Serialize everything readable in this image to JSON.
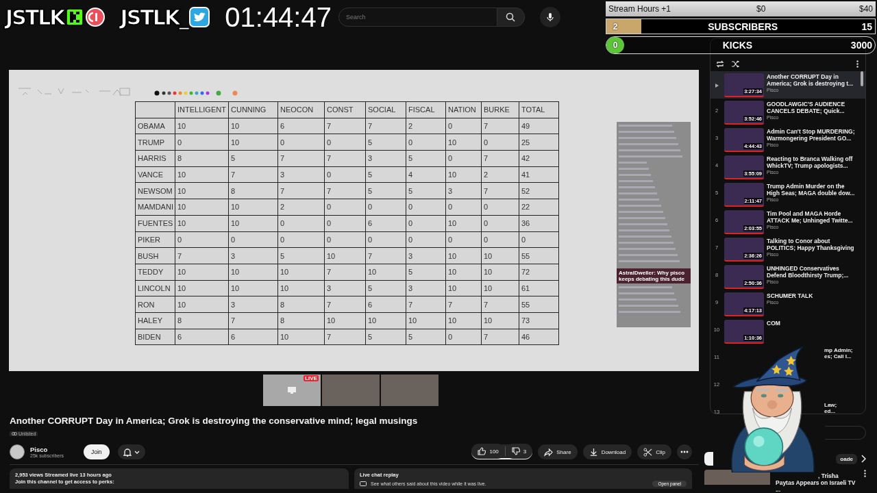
{
  "overlay": {
    "logos": [
      {
        "text": "JSTLK",
        "kind": "kick"
      },
      {
        "text": "JSTLK_",
        "kind": "twitter"
      }
    ],
    "timer": "01:44:47"
  },
  "search": {
    "placeholder": "Search"
  },
  "goals": [
    {
      "kind": "hours",
      "label": "Stream Hours +1",
      "start": "$0",
      "target": "$40"
    },
    {
      "kind": "bar",
      "label": "SUBSCRIBERS",
      "current": "2",
      "target": "15",
      "level": 0.13
    },
    {
      "kind": "pill",
      "label": "KICKS",
      "current": "0",
      "target": "3000",
      "level": 0
    }
  ],
  "video": {
    "table": {
      "columns": [
        "INTELLIGENT",
        "CUNNING",
        "NEOCON",
        "CONST",
        "SOCIAL",
        "FISCAL",
        "NATION",
        "BURKE",
        "TOTAL"
      ],
      "rows": [
        {
          "name": "OBAMA",
          "cells": [
            "10",
            "10",
            "6",
            "7",
            "7",
            "2",
            "0",
            "7",
            "49"
          ]
        },
        {
          "name": "TRUMP",
          "cells": [
            "0",
            "10",
            "0",
            "0",
            "5",
            "0",
            "10",
            "0",
            "25"
          ]
        },
        {
          "name": "HARRIS",
          "cells": [
            "8",
            "5",
            "7",
            "7",
            "3",
            "5",
            "0",
            "7",
            "42"
          ]
        },
        {
          "name": "VANCE",
          "cells": [
            "10",
            "7",
            "3",
            "0",
            "5",
            "4",
            "10",
            "2",
            "41"
          ]
        },
        {
          "name": "NEWSOM",
          "cells": [
            "10",
            "8",
            "7",
            "7",
            "5",
            "5",
            "3",
            "7",
            "52"
          ]
        },
        {
          "name": "MAMDANI",
          "cells": [
            "10",
            "10",
            "2",
            "0",
            "0",
            "0",
            "0",
            "0",
            "22"
          ]
        },
        {
          "name": "FUENTES",
          "cells": [
            "10",
            "10",
            "0",
            "0",
            "6",
            "0",
            "10",
            "0",
            "36"
          ]
        },
        {
          "name": "PIKER",
          "cells": [
            "0",
            "0",
            "0",
            "0",
            "0",
            "0",
            "0",
            "0",
            "0"
          ]
        },
        {
          "name": "BUSH",
          "cells": [
            "7",
            "3",
            "5",
            "10",
            "7",
            "3",
            "10",
            "10",
            "55"
          ]
        },
        {
          "name": "TEDDY",
          "cells": [
            "10",
            "10",
            "10",
            "7",
            "10",
            "5",
            "10",
            "10",
            "72"
          ]
        },
        {
          "name": "LINCOLN",
          "cells": [
            "10",
            "10",
            "10",
            "3",
            "5",
            "3",
            "10",
            "10",
            "61"
          ]
        },
        {
          "name": "RON",
          "cells": [
            "10",
            "3",
            "8",
            "7",
            "6",
            "7",
            "7",
            "7",
            "55"
          ]
        },
        {
          "name": "HALEY",
          "cells": [
            "8",
            "7",
            "8",
            "10",
            "10",
            "10",
            "10",
            "10",
            "73"
          ]
        },
        {
          "name": "BIDEN",
          "cells": [
            "6",
            "6",
            "10",
            "7",
            "5",
            "5",
            "0",
            "7",
            "46"
          ]
        }
      ]
    },
    "chat_highlight": {
      "user": "AstralDweller:",
      "text": "Why pisco keeps debating this dude"
    }
  },
  "participants": [
    {
      "kind": "screen",
      "badge": "LIVE"
    },
    {
      "kind": "camera"
    },
    {
      "kind": "camera"
    }
  ],
  "info": {
    "title": "Another CORRUPT Day in America; Grok is destroying the conservative mind; legal musings",
    "visibility": "Unlisted",
    "channel": "Pisco",
    "subscribers": "25k subscribers",
    "join": "Join",
    "likes": "100",
    "dislikes": "3",
    "actions": [
      {
        "kind": "share",
        "label": "Share"
      },
      {
        "kind": "download",
        "label": "Download"
      },
      {
        "kind": "clip",
        "label": "Clip"
      }
    ],
    "stats": "2,953 views  Streamed live 13 hours ago",
    "perks": "Join this channel to get access to perks:",
    "chat_replay": {
      "title": "Live chat replay",
      "text": "See what others said about this video while it was live.",
      "button": "Open panel"
    }
  },
  "playlist": {
    "items": [
      {
        "kind": "full",
        "selected": true,
        "title": "Another CORRUPT Day in America; Grok is destroying t...",
        "duration": "3:27:34",
        "channel": "Pisco"
      },
      {
        "kind": "full",
        "selected": false,
        "index": "2",
        "title": "GOODLAWGIC'S AUDIENCE CANCELS DEBATE; Quick...",
        "duration": "3:52:46",
        "channel": "Pisco"
      },
      {
        "kind": "full",
        "selected": false,
        "index": "3",
        "title": "Admin Can't Stop MURDERING; Warmongering President GO...",
        "duration": "4:44:43",
        "channel": "Pisco"
      },
      {
        "kind": "full",
        "selected": false,
        "index": "4",
        "title": "Reacting to Branca Walking off WhickTV; Trump apologists...",
        "duration": "3:55:09",
        "channel": "Pisco"
      },
      {
        "kind": "full",
        "selected": false,
        "index": "5",
        "title": "Trump Admin Murder on the High Seas; MAGA double dow...",
        "duration": "2:11:47",
        "channel": "Pisco"
      },
      {
        "kind": "full",
        "selected": false,
        "index": "6",
        "title": "Tim Pool and MAGA Horde ATTACK Me; Unhinged Twitte...",
        "duration": "2:03:55",
        "channel": "Pisco"
      },
      {
        "kind": "full",
        "selected": false,
        "index": "7",
        "title": "Talking to Conor about POLITICS; Happy Thanksgiving",
        "duration": "2:36:26",
        "channel": "Pisco"
      },
      {
        "kind": "full",
        "selected": false,
        "index": "8",
        "title": "UNHINGED Conservatives Defend Bloodthirsty Trump;...",
        "duration": "2:50:36",
        "channel": "Pisco"
      },
      {
        "kind": "full",
        "selected": false,
        "index": "9",
        "title": "SCHUMER TALK",
        "duration": "4:17:13",
        "channel": "Pisco"
      },
      {
        "kind": "partial",
        "selected": false,
        "index": "10",
        "title": "COM",
        "duration": "1:10:36"
      },
      {
        "kind": "obscured",
        "selected": false,
        "index": "11",
        "lines": [
          "mp Admin;",
          "es; Call I..."
        ]
      },
      {
        "kind": "obscured",
        "selected": false,
        "index": "12"
      },
      {
        "kind": "obscured",
        "selected": false,
        "index": "13",
        "lines": [
          "Law;",
          "ed..."
        ]
      }
    ]
  },
  "chips": [
    "oade"
  ],
  "recommendation": {
    "lines": [
      ", Trisha",
      "Paytas Appears on Israeli TV ..."
    ]
  }
}
